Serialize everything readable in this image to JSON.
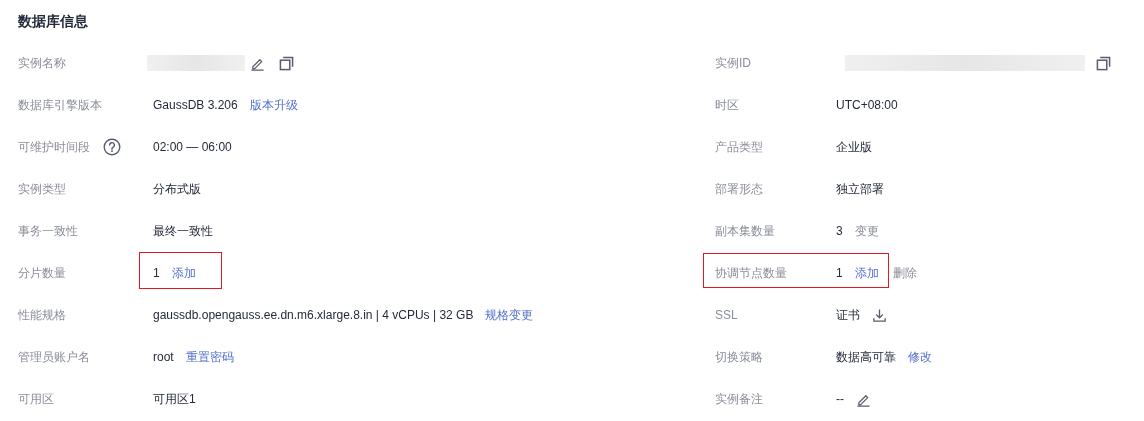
{
  "title": "数据库信息",
  "rows": [
    {
      "left": {
        "label": "实例名称",
        "value": {
          "kind": "masked"
        },
        "buttons": [
          {
            "kind": "edit"
          },
          {
            "kind": "copy"
          }
        ]
      },
      "right": {
        "label": "实例ID",
        "value": {
          "kind": "masked"
        },
        "buttons": [
          {
            "kind": "copy"
          }
        ]
      }
    },
    {
      "left": {
        "label": "数据库引擎版本",
        "value": {
          "kind": "text",
          "text": "GaussDB 3.206"
        },
        "actions": [
          {
            "label": "版本升级",
            "disabled": false
          }
        ]
      },
      "right": {
        "label": "时区",
        "value": {
          "kind": "text",
          "text": "UTC+08:00"
        }
      }
    },
    {
      "left": {
        "label": "可维护时间段",
        "help": true,
        "value": {
          "kind": "text",
          "text": "02:00 — 06:00"
        }
      },
      "right": {
        "label": "产品类型",
        "value": {
          "kind": "text",
          "text": "企业版"
        }
      }
    },
    {
      "left": {
        "label": "实例类型",
        "value": {
          "kind": "text",
          "text": "分布式版"
        }
      },
      "right": {
        "label": "部署形态",
        "value": {
          "kind": "text",
          "text": "独立部署"
        }
      }
    },
    {
      "left": {
        "label": "事务一致性",
        "value": {
          "kind": "text",
          "text": "最终一致性"
        }
      },
      "right": {
        "label": "副本集数量",
        "value": {
          "kind": "text",
          "text": "3"
        },
        "actions": [
          {
            "label": "变更",
            "disabled": true
          }
        ]
      }
    },
    {
      "left": {
        "label": "分片数量",
        "highlight": true,
        "value": {
          "kind": "text",
          "text": "1"
        },
        "actions": [
          {
            "label": "添加",
            "disabled": false
          }
        ]
      },
      "right": {
        "label": "协调节点数量",
        "highlight": true,
        "value": {
          "kind": "text",
          "text": "1"
        },
        "actions": [
          {
            "label": "添加",
            "disabled": false
          },
          {
            "label": "删除",
            "disabled": true
          }
        ]
      }
    },
    {
      "left": {
        "label": "性能规格",
        "value": {
          "kind": "text",
          "text": "gaussdb.opengauss.ee.dn.m6.xlarge.8.in | 4 vCPUs | 32 GB"
        },
        "actions": [
          {
            "label": "规格变更",
            "disabled": false
          }
        ]
      },
      "right": {
        "label": "SSL",
        "value": {
          "kind": "text",
          "text": "证书"
        },
        "buttons": [
          {
            "kind": "download"
          }
        ]
      }
    },
    {
      "left": {
        "label": "管理员账户名",
        "value": {
          "kind": "text",
          "text": "root"
        },
        "actions": [
          {
            "label": "重置密码",
            "disabled": false
          }
        ]
      },
      "right": {
        "label": "切换策略",
        "value": {
          "kind": "text",
          "text": "数据高可靠"
        },
        "actions": [
          {
            "label": "修改",
            "disabled": false
          }
        ]
      }
    },
    {
      "left": {
        "label": "可用区",
        "value": {
          "kind": "text",
          "text": "可用区1"
        }
      },
      "right": {
        "label": "实例备注",
        "value": {
          "kind": "text",
          "text": "--"
        },
        "buttons": [
          {
            "kind": "edit"
          }
        ]
      }
    }
  ]
}
